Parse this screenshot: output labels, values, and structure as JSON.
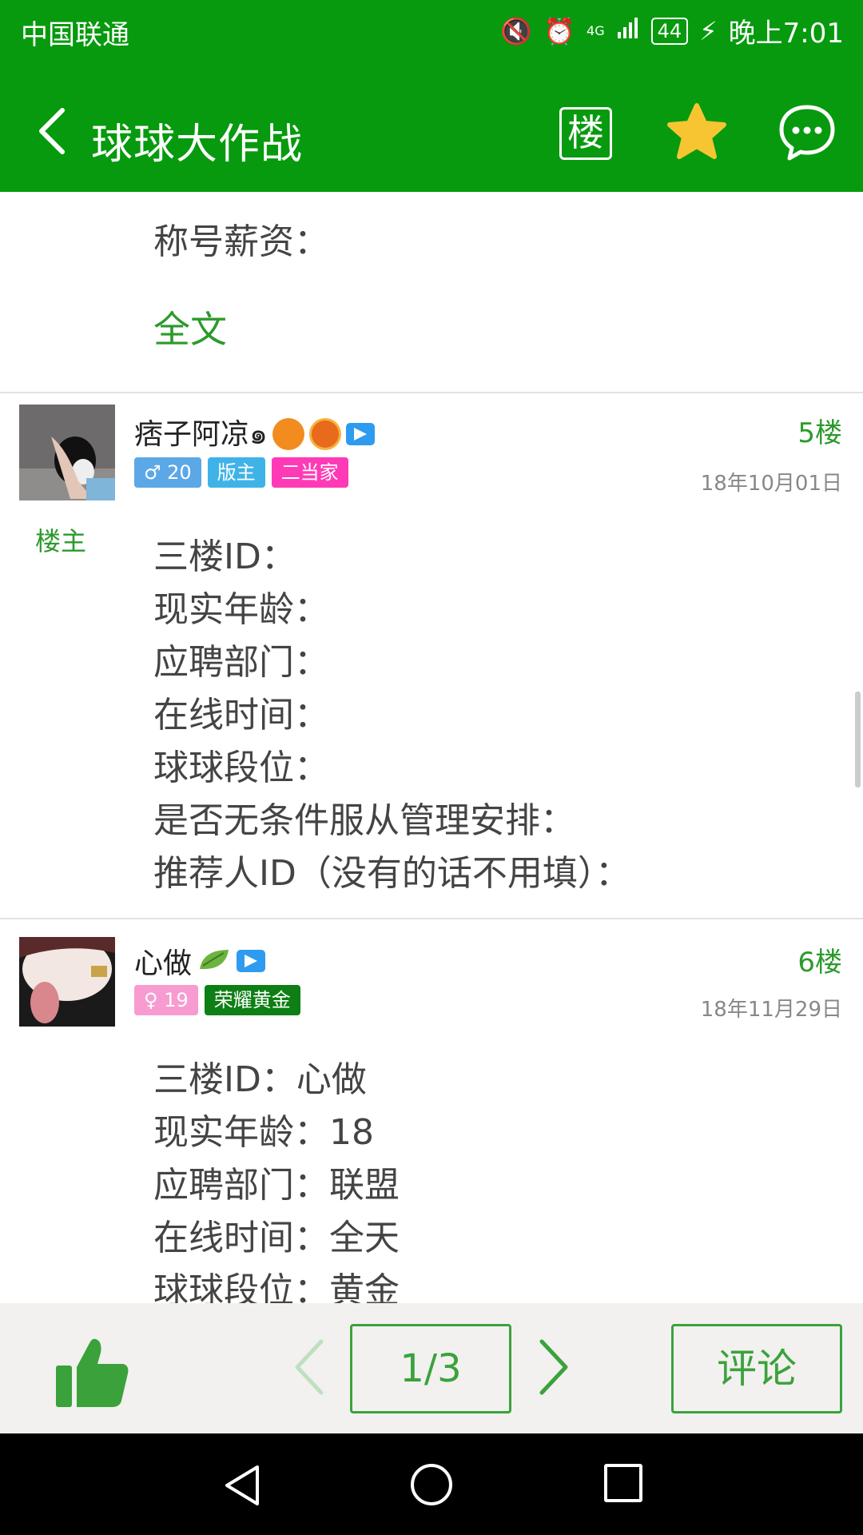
{
  "status_bar": {
    "carrier": "中国联通",
    "network": "4G",
    "battery": "44",
    "time": "晚上7:01"
  },
  "header": {
    "title": "球球大作战",
    "floor_button": "楼",
    "icons": [
      "back-arrow-icon",
      "star-icon",
      "chat-bubble-icon"
    ]
  },
  "top_post": {
    "line": "称号薪资：",
    "full_text_link": "全文"
  },
  "posts": [
    {
      "username": "痞子阿凉๑",
      "op_label": "楼主",
      "tags": [
        {
          "text": "♂ 20",
          "color": "#5CA8E6"
        },
        {
          "text": "版主",
          "color": "#3FB3E8"
        },
        {
          "text": "二当家",
          "color": "#FF3AB7"
        }
      ],
      "floor": "5楼",
      "date": "18年10月01日",
      "lines": [
        "三楼ID：",
        "现实年龄：",
        "应聘部门：",
        "在线时间：",
        "球球段位：",
        "是否无条件服从管理安排：",
        "推荐人ID（没有的话不用填）："
      ]
    },
    {
      "username": "心做",
      "tags": [
        {
          "text": "♀ 19",
          "color": "#F79BD1"
        },
        {
          "text": "荣耀黄金",
          "color": "#0E7F14"
        }
      ],
      "floor": "6楼",
      "date": "18年11月29日",
      "lines": [
        "三楼ID：心做",
        "现实年龄：18",
        "应聘部门：联盟",
        "在线时间：全天",
        "球球段位：黄金"
      ]
    }
  ],
  "bottom_bar": {
    "page": "1/3",
    "comment": "评论"
  },
  "colors": {
    "brand_green": "#079A0E",
    "link_green": "#2B9A2B",
    "star_yellow": "#F6C531"
  }
}
